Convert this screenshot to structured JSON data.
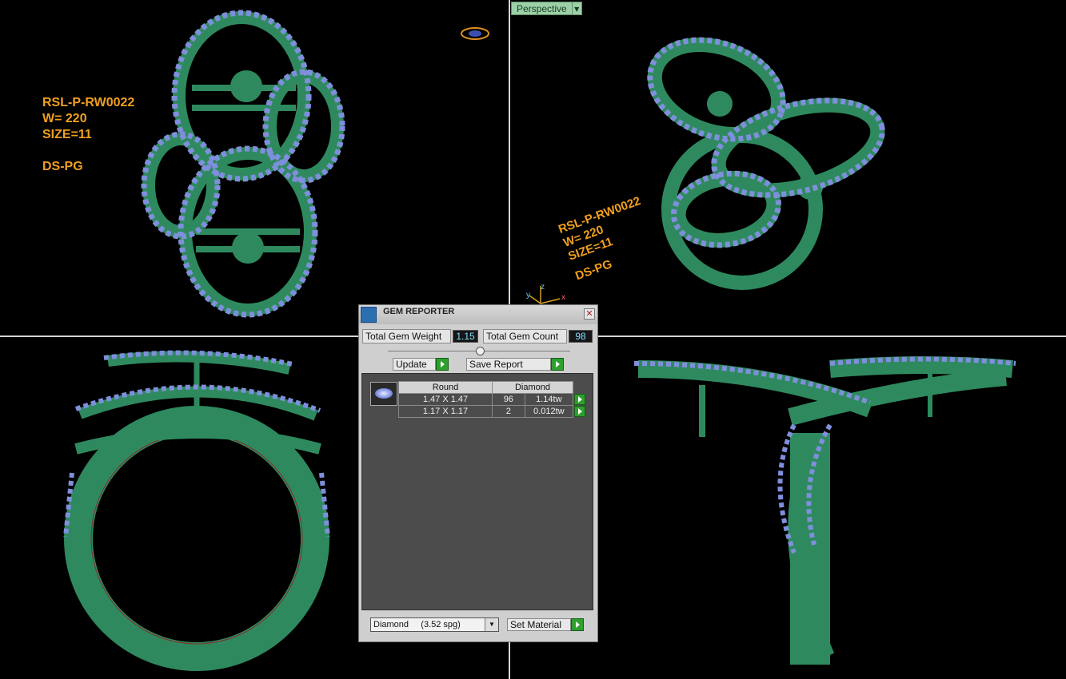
{
  "viewport": {
    "perspective_label": "Perspective",
    "dropdown_arrow": "▼"
  },
  "annotation": {
    "line1": "RSL-P-RW0022",
    "line2": "W= 220",
    "line3": "SIZE=11",
    "line4": "DS-PG"
  },
  "axis": {
    "z": "z",
    "x": "x",
    "y": "y"
  },
  "colors": {
    "metal": "#2e8a5e",
    "metal_dark": "#1d5e3f",
    "gem": "#7f8fdc",
    "label": "#f0a020"
  },
  "gem_reporter": {
    "title": "GEM REPORTER",
    "close": "✕",
    "total_weight_label": "Total Gem Weight",
    "total_weight_value": "1.15",
    "total_count_label": "Total Gem Count",
    "total_count_value": "98",
    "update_label": "Update",
    "save_report_label": "Save Report",
    "table": {
      "shape_header": "Round",
      "material_header": "Diamond",
      "rows": [
        {
          "size": "1.47 X 1.47",
          "count": "96",
          "weight": "1.14tw"
        },
        {
          "size": "1.17 X 1.17",
          "count": "2",
          "weight": "0.012tw"
        }
      ]
    },
    "material_select": "Diamond     (3.52 spg)",
    "set_material_label": "Set Material"
  }
}
